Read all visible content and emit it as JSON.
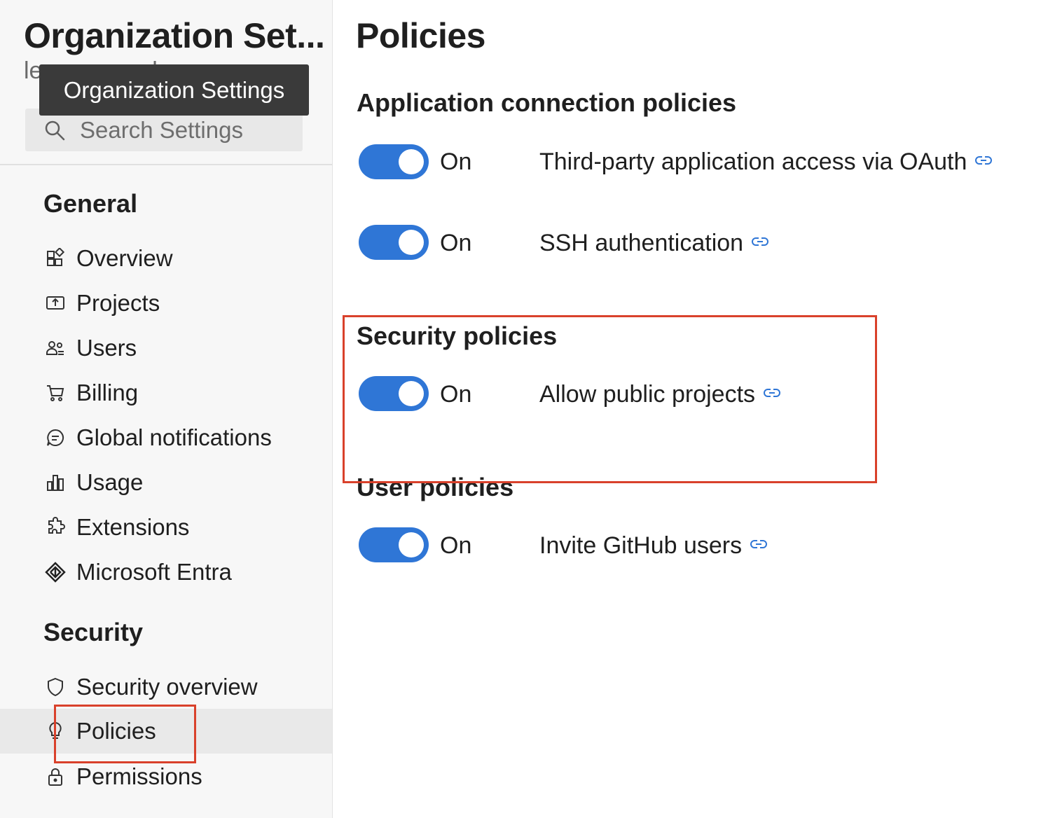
{
  "sidebar": {
    "title": "Organization Set...",
    "subtitle": "lennymowork",
    "tooltip": "Organization Settings",
    "search": {
      "placeholder": "Search Settings"
    },
    "groups": [
      {
        "title": "General",
        "items": [
          {
            "label": "Overview",
            "icon": "overview-icon"
          },
          {
            "label": "Projects",
            "icon": "projects-icon"
          },
          {
            "label": "Users",
            "icon": "users-icon"
          },
          {
            "label": "Billing",
            "icon": "cart-icon"
          },
          {
            "label": "Global notifications",
            "icon": "chat-icon"
          },
          {
            "label": "Usage",
            "icon": "bar-chart-icon"
          },
          {
            "label": "Extensions",
            "icon": "puzzle-icon"
          },
          {
            "label": "Microsoft Entra",
            "icon": "entra-icon"
          }
        ]
      },
      {
        "title": "Security",
        "items": [
          {
            "label": "Security overview",
            "icon": "shield-icon"
          },
          {
            "label": "Policies",
            "icon": "lightbulb-icon",
            "selected": true
          },
          {
            "label": "Permissions",
            "icon": "lock-icon"
          }
        ]
      }
    ]
  },
  "main": {
    "title": "Policies",
    "sections": [
      {
        "title": "Application connection policies",
        "policies": [
          {
            "state": "On",
            "enabled": true,
            "label": "Third-party application access via OAuth"
          },
          {
            "state": "On",
            "enabled": true,
            "label": "SSH authentication"
          }
        ]
      },
      {
        "title": "Security policies",
        "policies": [
          {
            "state": "On",
            "enabled": true,
            "label": "Allow public projects"
          }
        ]
      },
      {
        "title": "User policies",
        "policies": [
          {
            "state": "On",
            "enabled": true,
            "label": "Invite GitHub users"
          }
        ]
      }
    ]
  },
  "colors": {
    "accent": "#2f76d6",
    "highlight_box": "#d9412b",
    "sidebar_bg": "#f7f7f7",
    "selected_bg": "#e9e9e9"
  }
}
